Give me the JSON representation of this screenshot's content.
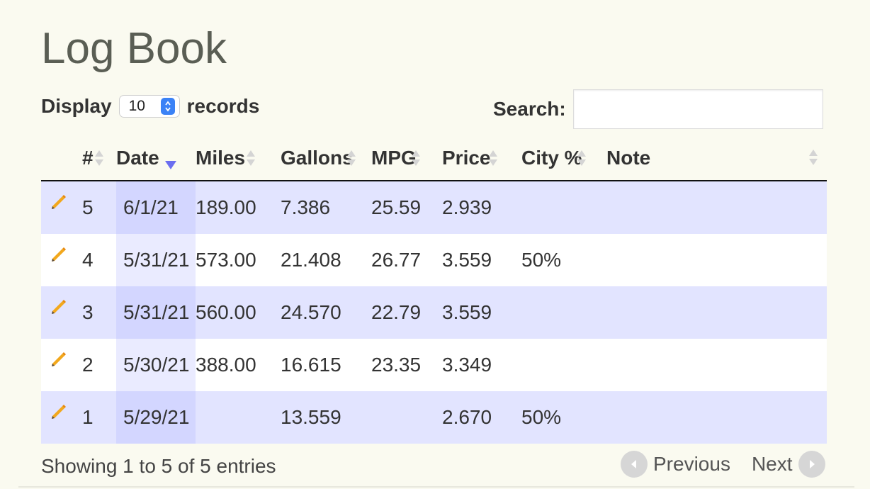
{
  "page": {
    "title": "Log Book"
  },
  "length_control": {
    "prefix": "Display",
    "value": "10",
    "suffix": "records"
  },
  "search": {
    "label": "Search:",
    "value": ""
  },
  "table": {
    "columns": [
      "#",
      "Date",
      "Miles",
      "Gallons",
      "MPG",
      "Price",
      "City %",
      "Note"
    ],
    "sorted_column": "Date",
    "sort_direction": "descending",
    "rows": [
      {
        "num": "5",
        "date": "6/1/21",
        "miles": "189.00",
        "gallons": "7.386",
        "mpg": "25.59",
        "price": "2.939",
        "city": "",
        "note": ""
      },
      {
        "num": "4",
        "date": "5/31/21",
        "miles": "573.00",
        "gallons": "21.408",
        "mpg": "26.77",
        "price": "3.559",
        "city": "50%",
        "note": ""
      },
      {
        "num": "3",
        "date": "5/31/21",
        "miles": "560.00",
        "gallons": "24.570",
        "mpg": "22.79",
        "price": "3.559",
        "city": "",
        "note": ""
      },
      {
        "num": "2",
        "date": "5/30/21",
        "miles": "388.00",
        "gallons": "16.615",
        "mpg": "23.35",
        "price": "3.349",
        "city": "",
        "note": ""
      },
      {
        "num": "1",
        "date": "5/29/21",
        "miles": "",
        "gallons": "13.559",
        "mpg": "",
        "price": "2.670",
        "city": "50%",
        "note": ""
      }
    ]
  },
  "footer": {
    "info": "Showing 1 to 5 of 5 entries",
    "previous_label": "Previous",
    "next_label": "Next"
  },
  "colors": {
    "background": "#fafaf0",
    "row_odd": "#e2e4ff",
    "row_odd_sorted": "#d3d6ff",
    "row_even_sorted": "#eaebff",
    "pencil": "#f2a81d",
    "sort_active": "#6b6ef0"
  },
  "icons": {
    "edit": "pencil-icon",
    "sort": "sort-both-icon",
    "sort_active": "sort-desc-icon",
    "previous": "arrow-left-circle-icon",
    "next": "arrow-right-circle-icon"
  }
}
